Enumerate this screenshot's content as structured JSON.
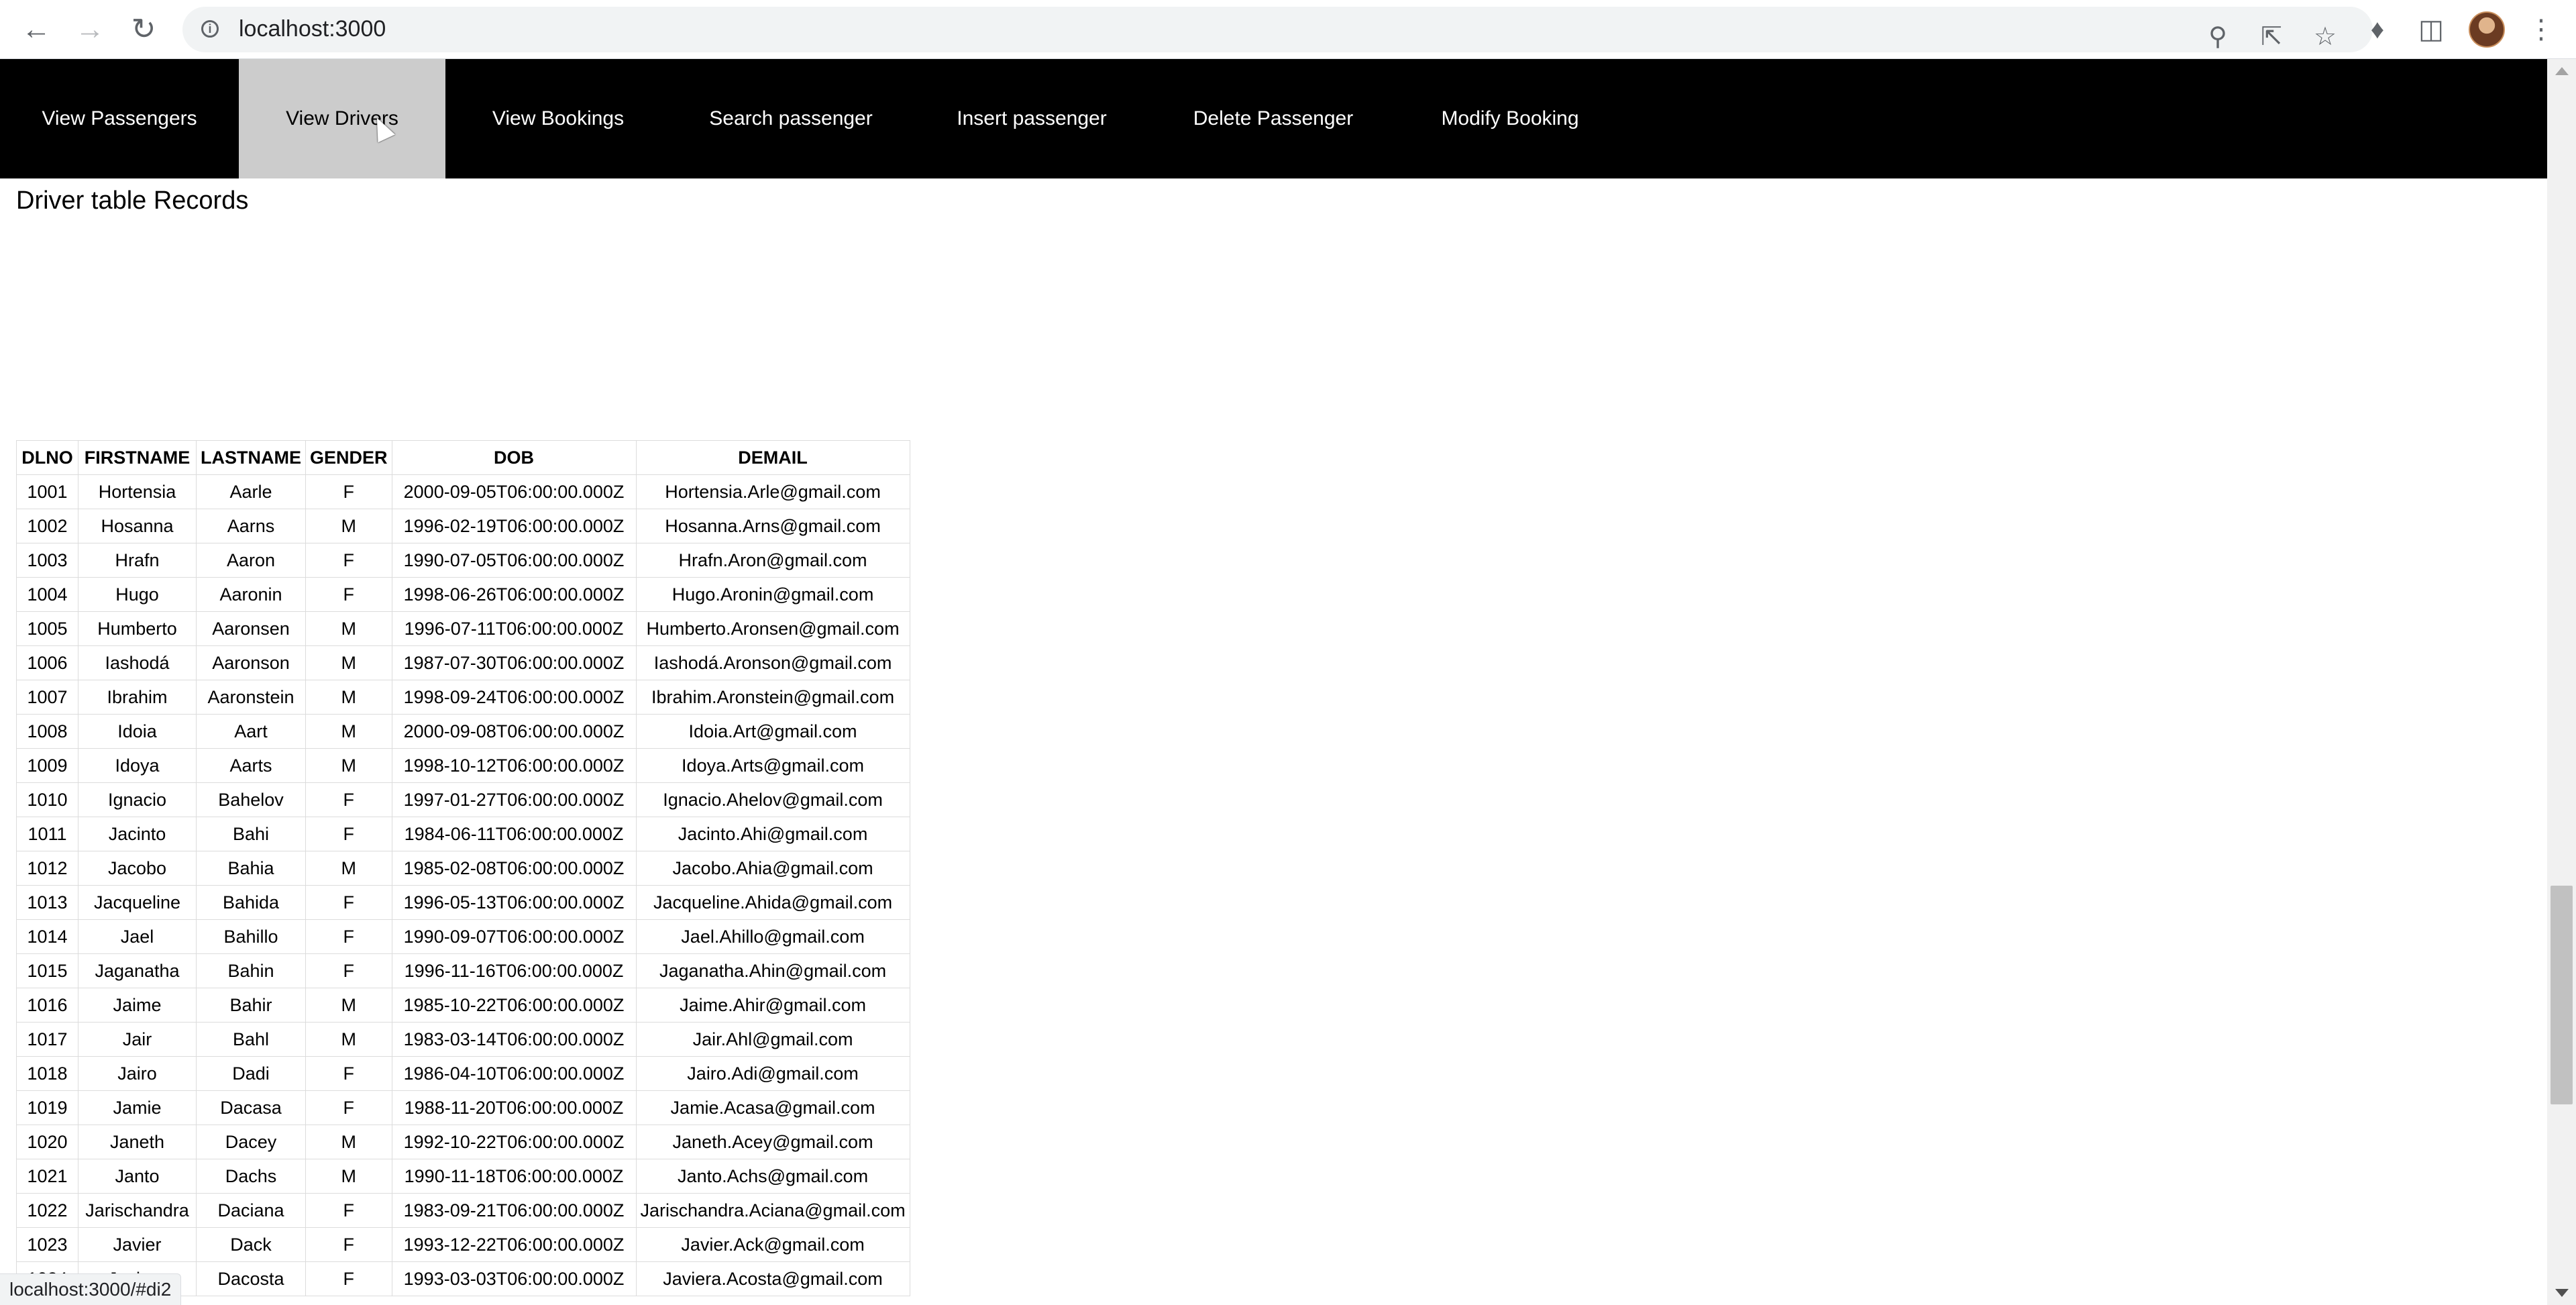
{
  "browser": {
    "url": "localhost:3000",
    "status_url": "localhost:3000/#di2",
    "icons": {
      "back": "back-arrow-icon",
      "forward": "forward-arrow-icon",
      "reload": "reload-icon",
      "info": "info-icon",
      "zoom": "zoom-icon",
      "share": "share-icon",
      "bookmark": "star-icon",
      "extensions": "puzzle-icon",
      "side_panel": "side-panel-icon",
      "profile": "avatar",
      "menu": "kebab-menu-icon"
    }
  },
  "nav": {
    "items": [
      {
        "label": "View Passengers"
      },
      {
        "label": "View Drivers",
        "active": true
      },
      {
        "label": "View Bookings"
      },
      {
        "label": "Search passenger"
      },
      {
        "label": "Insert passenger"
      },
      {
        "label": "Delete Passenger"
      },
      {
        "label": "Modify Booking"
      }
    ]
  },
  "page": {
    "title": "Driver table Records"
  },
  "table": {
    "headers": [
      "DLNO",
      "FIRSTNAME",
      "LASTNAME",
      "GENDER",
      "DOB",
      "DEMAIL"
    ],
    "rows": [
      [
        "1001",
        "Hortensia",
        "Aarle",
        "F",
        "2000-09-05T06:00:00.000Z",
        "Hortensia.Arle@gmail.com"
      ],
      [
        "1002",
        "Hosanna",
        "Aarns",
        "M",
        "1996-02-19T06:00:00.000Z",
        "Hosanna.Arns@gmail.com"
      ],
      [
        "1003",
        "Hrafn",
        "Aaron",
        "F",
        "1990-07-05T06:00:00.000Z",
        "Hrafn.Aron@gmail.com"
      ],
      [
        "1004",
        "Hugo",
        "Aaronin",
        "F",
        "1998-06-26T06:00:00.000Z",
        "Hugo.Aronin@gmail.com"
      ],
      [
        "1005",
        "Humberto",
        "Aaronsen",
        "M",
        "1996-07-11T06:00:00.000Z",
        "Humberto.Aronsen@gmail.com"
      ],
      [
        "1006",
        "Iashodá",
        "Aaronson",
        "M",
        "1987-07-30T06:00:00.000Z",
        "Iashodá.Aronson@gmail.com"
      ],
      [
        "1007",
        "Ibrahim",
        "Aaronstein",
        "M",
        "1998-09-24T06:00:00.000Z",
        "Ibrahim.Aronstein@gmail.com"
      ],
      [
        "1008",
        "Idoia",
        "Aart",
        "M",
        "2000-09-08T06:00:00.000Z",
        "Idoia.Art@gmail.com"
      ],
      [
        "1009",
        "Idoya",
        "Aarts",
        "M",
        "1998-10-12T06:00:00.000Z",
        "Idoya.Arts@gmail.com"
      ],
      [
        "1010",
        "Ignacio",
        "Bahelov",
        "F",
        "1997-01-27T06:00:00.000Z",
        "Ignacio.Ahelov@gmail.com"
      ],
      [
        "1011",
        "Jacinto",
        "Bahi",
        "F",
        "1984-06-11T06:00:00.000Z",
        "Jacinto.Ahi@gmail.com"
      ],
      [
        "1012",
        "Jacobo",
        "Bahia",
        "M",
        "1985-02-08T06:00:00.000Z",
        "Jacobo.Ahia@gmail.com"
      ],
      [
        "1013",
        "Jacqueline",
        "Bahida",
        "F",
        "1996-05-13T06:00:00.000Z",
        "Jacqueline.Ahida@gmail.com"
      ],
      [
        "1014",
        "Jael",
        "Bahillo",
        "F",
        "1990-09-07T06:00:00.000Z",
        "Jael.Ahillo@gmail.com"
      ],
      [
        "1015",
        "Jaganatha",
        "Bahin",
        "F",
        "1996-11-16T06:00:00.000Z",
        "Jaganatha.Ahin@gmail.com"
      ],
      [
        "1016",
        "Jaime",
        "Bahir",
        "M",
        "1985-10-22T06:00:00.000Z",
        "Jaime.Ahir@gmail.com"
      ],
      [
        "1017",
        "Jair",
        "Bahl",
        "M",
        "1983-03-14T06:00:00.000Z",
        "Jair.Ahl@gmail.com"
      ],
      [
        "1018",
        "Jairo",
        "Dadi",
        "F",
        "1986-04-10T06:00:00.000Z",
        "Jairo.Adi@gmail.com"
      ],
      [
        "1019",
        "Jamie",
        "Dacasa",
        "F",
        "1988-11-20T06:00:00.000Z",
        "Jamie.Acasa@gmail.com"
      ],
      [
        "1020",
        "Janeth",
        "Dacey",
        "M",
        "1992-10-22T06:00:00.000Z",
        "Janeth.Acey@gmail.com"
      ],
      [
        "1021",
        "Janto",
        "Dachs",
        "M",
        "1990-11-18T06:00:00.000Z",
        "Janto.Achs@gmail.com"
      ],
      [
        "1022",
        "Jarischandra",
        "Daciana",
        "F",
        "1983-09-21T06:00:00.000Z",
        "Jarischandra.Aciana@gmail.com"
      ],
      [
        "1023",
        "Javier",
        "Dack",
        "F",
        "1993-12-22T06:00:00.000Z",
        "Javier.Ack@gmail.com"
      ],
      [
        "1024",
        "Javiera",
        "Dacosta",
        "F",
        "1993-03-03T06:00:00.000Z",
        "Javiera.Acosta@gmail.com"
      ]
    ]
  },
  "colors": {
    "nav_background": "#000000",
    "nav_active_background": "#cccccc",
    "nav_text": "#ffffff"
  }
}
